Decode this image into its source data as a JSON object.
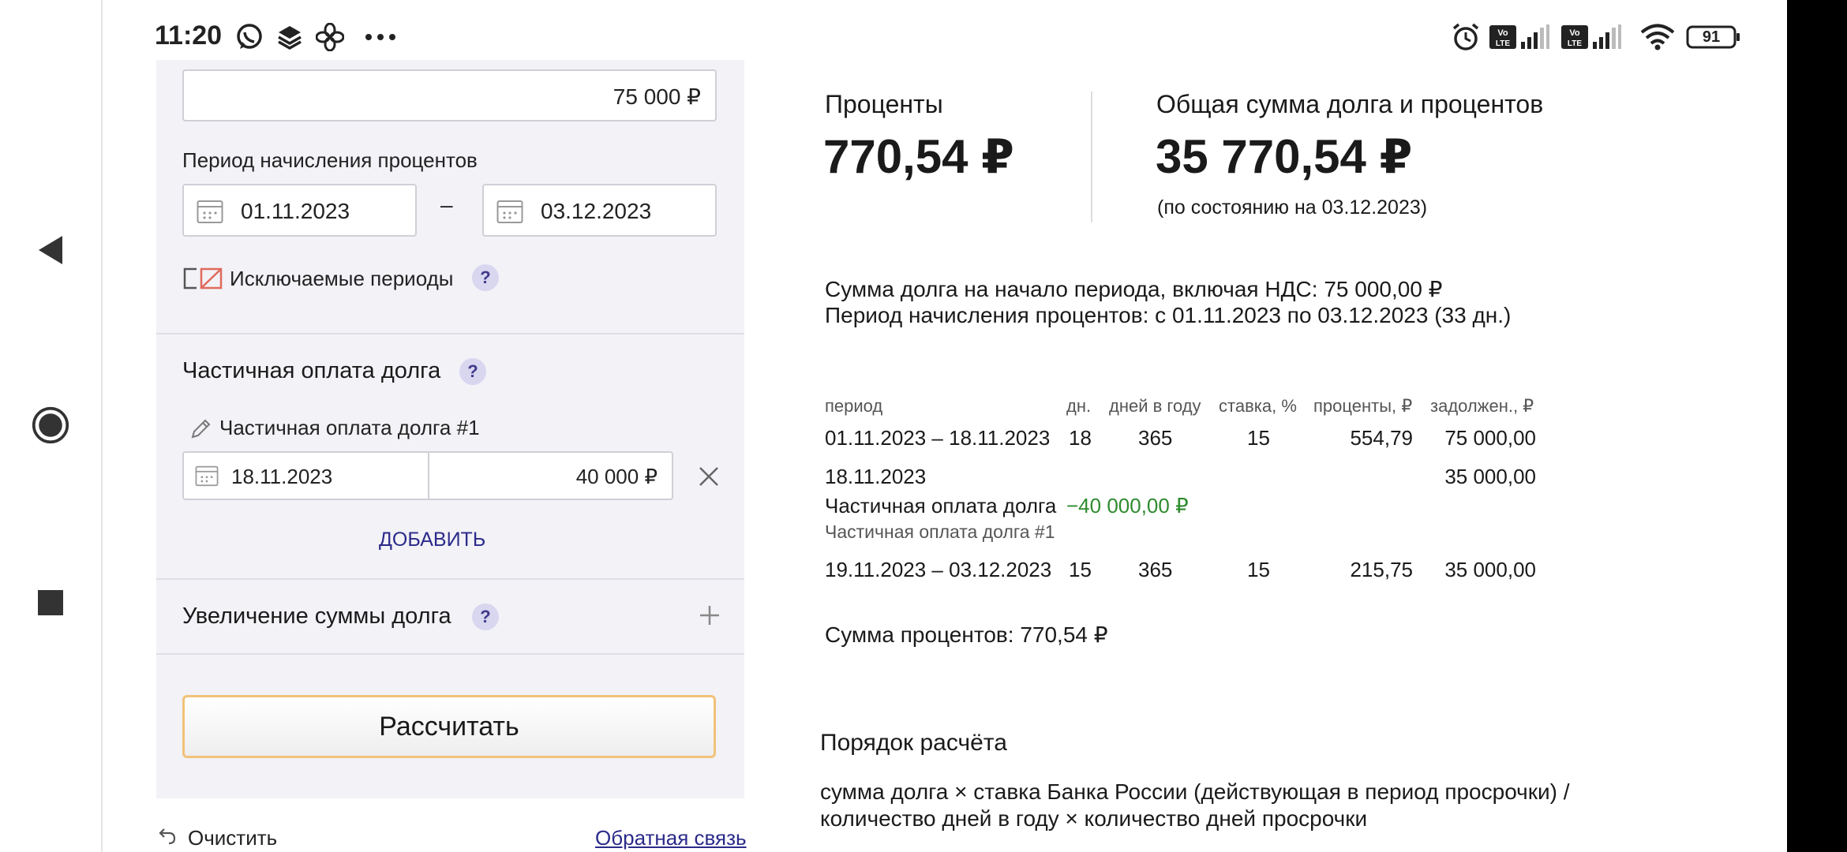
{
  "status_bar": {
    "time": "11:20",
    "battery": "91",
    "left_icons": [
      "whatsapp-icon",
      "layers-icon",
      "fan-icon",
      "more-dots-icon"
    ],
    "right_icons": [
      "alarm-icon",
      "volte-icon",
      "signal-icon",
      "volte-icon",
      "signal-icon",
      "wifi-icon",
      "battery-icon"
    ]
  },
  "navigation": [
    "back-icon",
    "home-icon",
    "recents-icon"
  ],
  "form": {
    "debt_amount_value": "75 000 ₽",
    "period_label": "Период начисления процентов",
    "period_from": "01.11.2023",
    "period_dash": "–",
    "period_to": "03.12.2023",
    "excluded_periods_label": "Исключаемые периоды",
    "help_glyph": "?",
    "partial_payment_title": "Частичная оплата долга",
    "partial_payment_item_label": "Частичная оплата долга #1",
    "partial_payment_date": "18.11.2023",
    "partial_payment_amount": "40 000 ₽",
    "add_label": "ДОБАВИТЬ",
    "increase_title": "Увеличение суммы долга",
    "calculate_label": "Рассчитать",
    "clear_label": "Очистить",
    "feedback_label": "Обратная связь"
  },
  "results": {
    "interest_label": "Проценты",
    "interest_value": "770,54 ₽",
    "total_label": "Общая сумма долга и процентов",
    "total_value": "35 770,54 ₽",
    "as_of": "(по состоянию на 03.12.2023)",
    "summary_line1": "Сумма долга на начало периода, включая НДС: 75 000,00 ₽",
    "summary_line2": "Период начисления процентов: с 01.11.2023 по 03.12.2023 (33 дн.)",
    "table": {
      "headers": [
        "период",
        "дн.",
        "дней в году",
        "ставка, %",
        "проценты, ₽",
        "задолжен., ₽"
      ],
      "row1": [
        "01.11.2023 – 18.11.2023",
        "18",
        "365",
        "15",
        "554,79",
        "75 000,00"
      ],
      "payment_date": "18.11.2023",
      "payment_debt": "35 000,00",
      "payment_label": "Частичная оплата долга",
      "payment_amount": "−40 000,00 ₽",
      "payment_sublabel": "Частичная оплата долга #1",
      "row2": [
        "19.11.2023 – 03.12.2023",
        "15",
        "365",
        "15",
        "215,75",
        "35 000,00"
      ]
    },
    "interest_sum": "Сумма процентов: 770,54 ₽",
    "method_title": "Порядок расчёта",
    "method_line1": "сумма долга × ставка Банка России (действующая в период просрочки) /",
    "method_line2": "количество дней в году × количество дней просрочки"
  },
  "colors": {
    "panel_bg": "#f2f2f7",
    "accent_link": "#2a2a8a",
    "payment_green": "#2e8b2e",
    "button_border": "#f2c178"
  }
}
